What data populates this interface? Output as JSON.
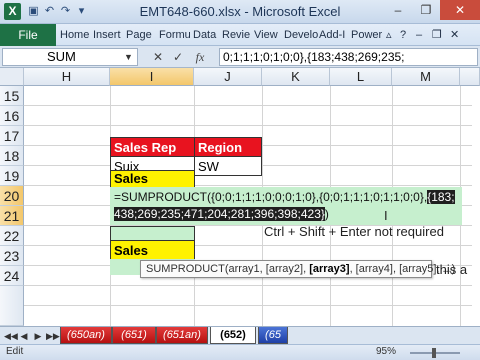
{
  "window": {
    "title": "EMT648-660.xlsx - Microsoft Excel",
    "app_icon": "X",
    "quick_access": [
      "save-icon",
      "undo-icon",
      "redo-icon",
      "dropdown-icon"
    ],
    "controls": {
      "minimize": "–",
      "restore": "❐",
      "close": "✕"
    }
  },
  "ribbon": {
    "file_label": "File",
    "tabs": [
      "Home",
      "Insert",
      "Page",
      "Formu",
      "Data",
      "Revie",
      "View",
      "Develo",
      "Add-I",
      "Power"
    ],
    "accent": "#1e7145"
  },
  "formula_bar": {
    "name_box": "SUM",
    "cancel": "✕",
    "enter": "✓",
    "fx": "fx",
    "formula": "0;1;1;1;0;1;0;0},{183;438;269;235;"
  },
  "grid": {
    "columns": [
      "H",
      "I",
      "J",
      "K",
      "L",
      "M"
    ],
    "selected_column": "I",
    "rows": [
      "15",
      "16",
      "17",
      "18",
      "19",
      "20",
      "21",
      "22",
      "23",
      "24"
    ],
    "selected_rows": [
      "20",
      "21"
    ]
  },
  "cells": {
    "sales_rep_header": "Sales Rep",
    "region_header": "Region",
    "sales_rep_value": "Suix",
    "region_value": "SW",
    "sales_label_19": "Sales",
    "sales_label_23": "Sales",
    "formula_line1_plain": "=SUMPRODUCT({0;0;1;1;1;0;0;0;1;0},{0;0;1;1;1;0;1;1;0;0},",
    "formula_line1_hl": "{183;",
    "formula_line2_hl": "438;269;235;471;204;281;396;398;423}",
    "formula_line2_plain": ")",
    "note": "Ctrl + Shift + Enter not required",
    "partial_right": "this a"
  },
  "tooltip": {
    "pre": "SUMPRODUCT(array1, [array2], ",
    "bold": "[array3]",
    "post": ", [array4], [array5], ...)"
  },
  "sheet_tabs": {
    "nav": [
      "◀◀",
      "◀",
      "▶",
      "▶▶"
    ],
    "tabs": [
      "(650an)",
      "(651)",
      "(651an)",
      "(652)",
      "(65"
    ],
    "active": "(652)"
  },
  "status_bar": {
    "mode": "Edit",
    "zoom": "95%",
    "zoom_level": 0.95
  },
  "colors": {
    "header_red": "#e8131f",
    "highlight_yellow": "#fff200",
    "selection_green": "#c6efce",
    "excel_green": "#1e7145"
  }
}
